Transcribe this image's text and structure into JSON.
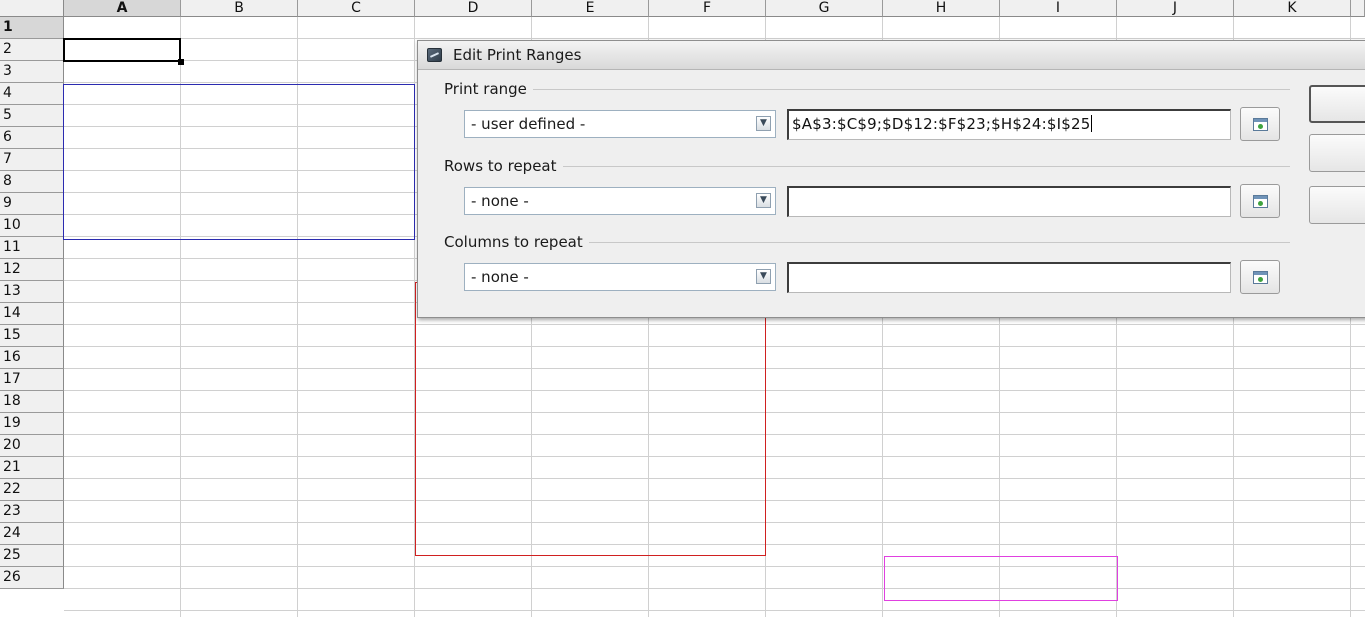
{
  "spreadsheet": {
    "columns": [
      "A",
      "B",
      "C",
      "D",
      "E",
      "F",
      "G",
      "H",
      "I",
      "J",
      "K"
    ],
    "active_column": "A",
    "rows": [
      "1",
      "2",
      "3",
      "4",
      "5",
      "6",
      "7",
      "8",
      "9",
      "10",
      "11",
      "12",
      "13",
      "14",
      "15",
      "16",
      "17",
      "18",
      "19",
      "20",
      "21",
      "22",
      "23",
      "24",
      "25",
      "26"
    ],
    "active_row": "1",
    "range_colors": {
      "range1": "#2b2bb0",
      "range2": "#d02020",
      "range3": "#e040e0"
    }
  },
  "dialog": {
    "title": "Edit Print Ranges",
    "title_icon": "dialog-app-icon",
    "print_range": {
      "label": "Print range",
      "selected": "- user defined -",
      "value": "$A$3:$C$9;$D$12:$F$23;$H$24:$I$25"
    },
    "rows_to_repeat": {
      "label": "Rows to repeat",
      "selected": "- none -",
      "value": ""
    },
    "columns_to_repeat": {
      "label": "Columns to repeat",
      "selected": "- none -",
      "value": ""
    },
    "shrink_icon": "shrink-dialog-icon",
    "dropdown_icon": "chevron-down-icon"
  }
}
